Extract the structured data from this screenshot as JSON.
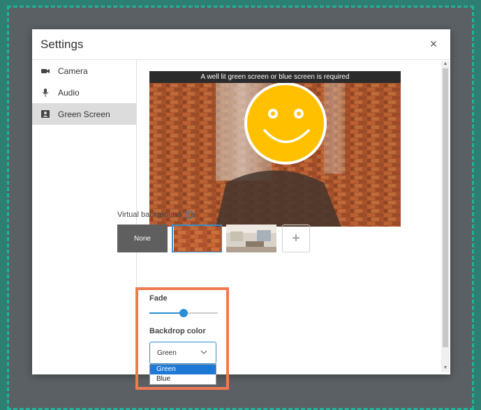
{
  "dialog": {
    "title": "Settings",
    "close_label": "×"
  },
  "sidebar": {
    "items": [
      {
        "label": "Camera",
        "icon": "camera-icon",
        "active": false
      },
      {
        "label": "Audio",
        "icon": "microphone-icon",
        "active": false
      },
      {
        "label": "Green Screen",
        "icon": "green-screen-icon",
        "active": true
      }
    ]
  },
  "video": {
    "banner": "A well lit green screen or blue screen is required"
  },
  "virtual_background": {
    "label": "Virtual background",
    "none_label": "None",
    "add_label": "+"
  },
  "fade": {
    "label": "Fade",
    "value": 0.5
  },
  "backdrop": {
    "label": "Backdrop color",
    "selected": "Green",
    "options": [
      "Green",
      "Blue"
    ]
  },
  "colors": {
    "accent": "#2a8fd6",
    "highlight": "#f07a52",
    "frame": "#1fb39a"
  }
}
